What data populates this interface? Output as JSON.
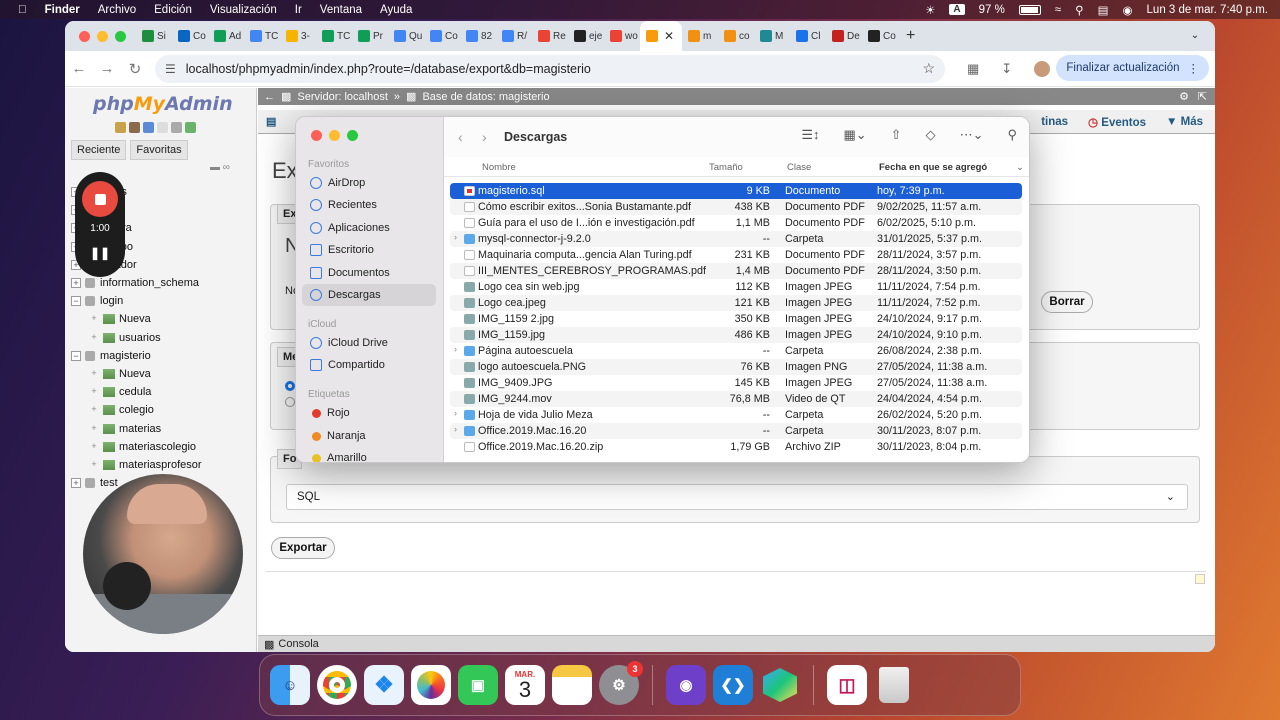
{
  "menubar": {
    "apple": "",
    "app": "Finder",
    "menus": [
      "Archivo",
      "Edición",
      "Visualización",
      "Ir",
      "Ventana",
      "Ayuda"
    ],
    "input_source": "A",
    "battery": "97 %",
    "datetime": "Lun 3 de mar.  7:40 p.m."
  },
  "browser": {
    "tabs": [
      {
        "label": "Si",
        "color": "#1e8e3e"
      },
      {
        "label": "Co",
        "color": "#0a66c2"
      },
      {
        "label": "Ad",
        "color": "#0f9d58"
      },
      {
        "label": "TC",
        "color": "#4285f4"
      },
      {
        "label": "3-",
        "color": "#f4b400"
      },
      {
        "label": "TC",
        "color": "#0f9d58"
      },
      {
        "label": "Pr",
        "color": "#0f9d58"
      },
      {
        "label": "Qu",
        "color": "#4285f4"
      },
      {
        "label": "Co",
        "color": "#4285f4"
      },
      {
        "label": "82",
        "color": "#4285f4"
      },
      {
        "label": "R/",
        "color": "#4285f4"
      },
      {
        "label": "Re",
        "color": "#ea4335"
      },
      {
        "label": "eje",
        "color": "#222222"
      },
      {
        "label": "wo",
        "color": "#ea4335"
      },
      {
        "label": "",
        "color": "#f89c0e",
        "active": true
      },
      {
        "label": "m",
        "color": "#f29111"
      },
      {
        "label": "co",
        "color": "#f29111"
      },
      {
        "label": "M",
        "color": "#1f8a93"
      },
      {
        "label": "Cl",
        "color": "#1a73e8"
      },
      {
        "label": "De",
        "color": "#c5221f"
      },
      {
        "label": "Co",
        "color": "#222222"
      }
    ],
    "url": "localhost/phpmyadmin/index.php?route=/database/export&db=magisterio",
    "update_label": "Finalizar actualización"
  },
  "pma": {
    "logo_php": "php",
    "logo_my": "My",
    "logo_admin": "Admin",
    "left_tabs": [
      "Reciente",
      "Favoritas"
    ],
    "tree": [
      {
        "label": "datos",
        "level": 1
      },
      {
        "label": "mplo",
        "level": 1
      },
      {
        "label": "Nueva",
        "level": 1
      },
      {
        "label": "equipo",
        "level": 1
      },
      {
        "label": "jugador",
        "level": 1
      },
      {
        "label": "information_schema",
        "level": 1
      },
      {
        "label": "login",
        "level": 1
      },
      {
        "label": "Nueva",
        "level": 2
      },
      {
        "label": "usuarios",
        "level": 2
      },
      {
        "label": "magisterio",
        "level": 1
      },
      {
        "label": "Nueva",
        "level": 2
      },
      {
        "label": "cedula",
        "level": 2
      },
      {
        "label": "colegio",
        "level": 2
      },
      {
        "label": "materias",
        "level": 2
      },
      {
        "label": "materiascolegio",
        "level": 2
      },
      {
        "label": "materiasprofesor",
        "level": 2
      },
      {
        "label": "test",
        "level": 1
      }
    ],
    "breadcrumb_server": "Servidor: localhost",
    "breadcrumb_db": "Base de datos: magisterio",
    "topnav_right": [
      "tinas",
      "Eventos",
      "Más"
    ],
    "title_fragment": "Ex",
    "panel_labels": {
      "ex": "Ex",
      "n": "N",
      "no": "No",
      "me": "Me",
      "fo": "Fo"
    },
    "borrar": "Borrar",
    "format_value": "SQL",
    "export_button": "Exportar",
    "console": "Consola"
  },
  "finder": {
    "location": "Descargas",
    "sections": {
      "favorites": "Favoritos",
      "icloud": "iCloud",
      "tags": "Etiquetas"
    },
    "favorites": [
      "AirDrop",
      "Recientes",
      "Aplicaciones",
      "Escritorio",
      "Documentos",
      "Descargas"
    ],
    "icloud": [
      "iCloud Drive",
      "Compartido"
    ],
    "tags": [
      {
        "label": "Rojo",
        "color": "#e23b2e"
      },
      {
        "label": "Naranja",
        "color": "#f08a24"
      },
      {
        "label": "Amarillo",
        "color": "#e8c224"
      }
    ],
    "columns": {
      "name": "Nombre",
      "size": "Tamaño",
      "kind": "Clase",
      "date": "Fecha en que se agregó"
    },
    "files": [
      {
        "name": "magisterio.sql",
        "size": "9 KB",
        "kind": "Documento",
        "date": "hoy, 7:39 p.m.",
        "icon": "sql",
        "selected": true
      },
      {
        "name": "Cómo escribir exitos...Sonia Bustamante.pdf",
        "size": "438 KB",
        "kind": "Documento PDF",
        "date": "9/02/2025, 11:57 a.m.",
        "icon": "doc"
      },
      {
        "name": "Guía para el uso de I...ión e investigación.pdf",
        "size": "1,1 MB",
        "kind": "Documento PDF",
        "date": "6/02/2025, 5:10 p.m.",
        "icon": "doc"
      },
      {
        "name": "mysql-connector-j-9.2.0",
        "size": "--",
        "kind": "Carpeta",
        "date": "31/01/2025, 5:37 p.m.",
        "icon": "fold",
        "folder": true
      },
      {
        "name": "Maquinaria computa...gencia Alan Turing.pdf",
        "size": "231 KB",
        "kind": "Documento PDF",
        "date": "28/11/2024, 3:57 p.m.",
        "icon": "doc"
      },
      {
        "name": "III_MENTES_CEREBROSY_PROGRAMAS.pdf",
        "size": "1,4 MB",
        "kind": "Documento PDF",
        "date": "28/11/2024, 3:50 p.m.",
        "icon": "doc"
      },
      {
        "name": "Logo cea sin web.jpg",
        "size": "112 KB",
        "kind": "Imagen JPEG",
        "date": "11/11/2024, 7:54 p.m.",
        "icon": "img"
      },
      {
        "name": "Logo cea.jpeg",
        "size": "121 KB",
        "kind": "Imagen JPEG",
        "date": "11/11/2024, 7:52 p.m.",
        "icon": "img"
      },
      {
        "name": "IMG_1159 2.jpg",
        "size": "350 KB",
        "kind": "Imagen JPEG",
        "date": "24/10/2024, 9:17 p.m.",
        "icon": "img"
      },
      {
        "name": "IMG_1159.jpg",
        "size": "486 KB",
        "kind": "Imagen JPEG",
        "date": "24/10/2024, 9:10 p.m.",
        "icon": "img"
      },
      {
        "name": "Página autoescuela",
        "size": "--",
        "kind": "Carpeta",
        "date": "26/08/2024, 2:38 p.m.",
        "icon": "fold",
        "folder": true
      },
      {
        "name": "logo autoescuela.PNG",
        "size": "76 KB",
        "kind": "Imagen PNG",
        "date": "27/05/2024, 11:38 a.m.",
        "icon": "img"
      },
      {
        "name": "IMG_9409.JPG",
        "size": "145 KB",
        "kind": "Imagen JPEG",
        "date": "27/05/2024, 11:38 a.m.",
        "icon": "img"
      },
      {
        "name": "IMG_9244.mov",
        "size": "76,8 MB",
        "kind": "Video de QT",
        "date": "24/04/2024, 4:54 p.m.",
        "icon": "img"
      },
      {
        "name": "Hoja de vida Julio Meza",
        "size": "--",
        "kind": "Carpeta",
        "date": "26/02/2024, 5:20 p.m.",
        "icon": "fold",
        "folder": true
      },
      {
        "name": "Office.2019.Mac.16.20",
        "size": "--",
        "kind": "Carpeta",
        "date": "30/11/2023, 8:07 p.m.",
        "icon": "fold",
        "folder": true
      },
      {
        "name": "Office.2019.Mac.16.20.zip",
        "size": "1,79 GB",
        "kind": "Archivo ZIP",
        "date": "30/11/2023, 8:04 p.m.",
        "icon": "doc"
      }
    ]
  },
  "recorder": {
    "time": "1:00"
  },
  "dock": {
    "calendar_month": "MAR.",
    "calendar_day": "3",
    "settings_badge": "3"
  }
}
